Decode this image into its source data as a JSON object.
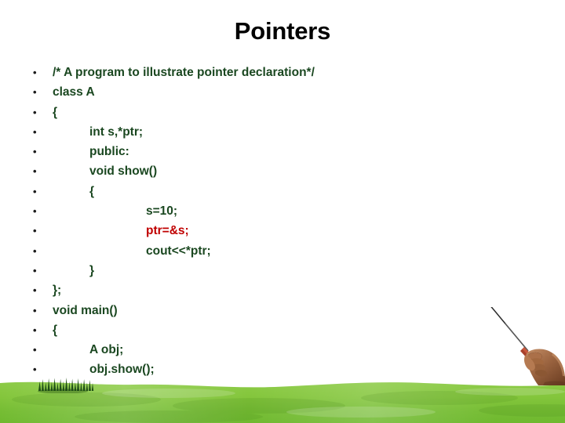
{
  "slide": {
    "title": "Pointers",
    "title_color": "#000000",
    "background_color": "#ffffff",
    "bullet_glyph": "•",
    "code_color": "#1a4720",
    "highlight_color": "#c00000",
    "grass_color": "#86c93e",
    "grass_dark_color": "#1d4d16",
    "lines": [
      {
        "text": "/* A program to illustrate pointer declaration*/",
        "indent": 0,
        "color": "#1a4720"
      },
      {
        "text": "class A",
        "indent": 0,
        "color": "#1a4720"
      },
      {
        "text": "{",
        "indent": 0,
        "color": "#1a4720"
      },
      {
        "text": "int s,*ptr;",
        "indent": 1,
        "color": "#1a4720"
      },
      {
        "text": "public:",
        "indent": 1,
        "color": "#1a4720"
      },
      {
        "text": "void show()",
        "indent": 1,
        "color": "#1a4720"
      },
      {
        "text": "{",
        "indent": 1,
        "color": "#1a4720"
      },
      {
        "text": "s=10;",
        "indent": 2,
        "color": "#1a4720"
      },
      {
        "text": "ptr=&s;",
        "indent": 2,
        "color": "#c00000"
      },
      {
        "text": "cout<<*ptr;",
        "indent": 2,
        "color": "#1a4720"
      },
      {
        "text": "}",
        "indent": 1,
        "color": "#1a4720"
      },
      {
        "text": "};",
        "indent": 0,
        "color": "#1a4720"
      },
      {
        "text": "void main()",
        "indent": 0,
        "color": "#1a4720"
      },
      {
        "text": "{",
        "indent": 0,
        "color": "#1a4720"
      },
      {
        "text": "A obj;",
        "indent": 1,
        "color": "#1a4720"
      },
      {
        "text": "obj.show();",
        "indent": 1,
        "color": "#1a4720"
      },
      {
        "text": "}",
        "indent": 0,
        "color": "#1a4720"
      }
    ],
    "decorations": {
      "grass_field": "grass-field-image",
      "grass_tuft": "grass-tuft-icon",
      "pointer_hand": "hand-holding-pointer-stick-image"
    }
  }
}
